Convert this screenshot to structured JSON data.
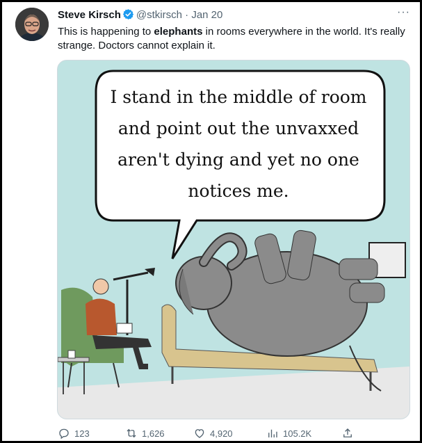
{
  "tweet": {
    "display_name": "Steve Kirsch",
    "handle": "@stkirsch",
    "separator": "·",
    "date": "Jan 20",
    "text_before": "This is happening to ",
    "text_bold": "elephants",
    "text_after": " in rooms everywhere in the world. It's really strange. Doctors cannot explain it."
  },
  "image": {
    "caption_lines": [
      "I stand in the middle of room",
      "and point out the unvaxxed",
      "aren't dying and yet no one",
      "notices me."
    ]
  },
  "actions": {
    "replies": "123",
    "retweets": "1,626",
    "likes": "4,920",
    "views": "105.2K"
  },
  "colors": {
    "verified": "#1d9bf0",
    "secondary_text": "#536471",
    "primary_text": "#0f1419"
  },
  "icons": [
    "verified-badge-icon",
    "more-icon",
    "reply-icon",
    "retweet-icon",
    "like-icon",
    "views-icon",
    "share-icon"
  ]
}
